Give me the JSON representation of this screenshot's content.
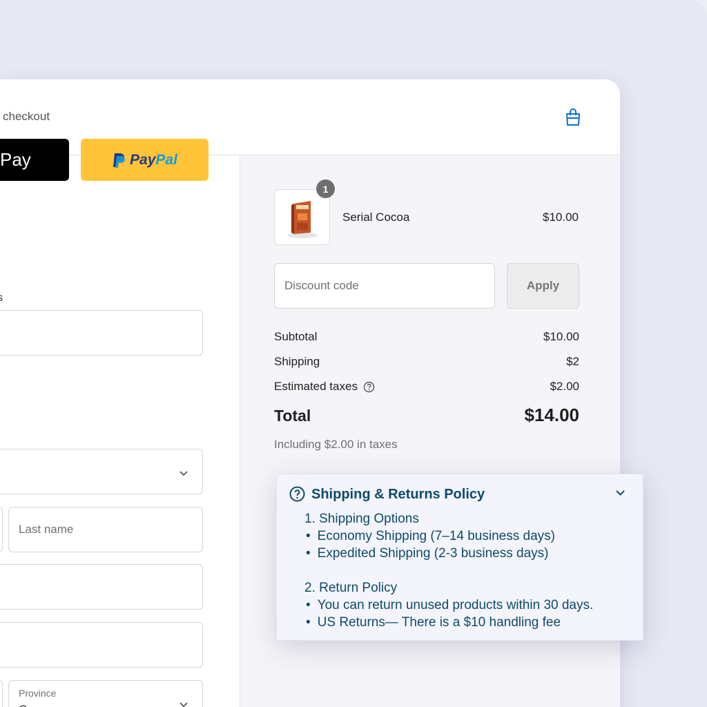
{
  "checkout": {
    "express_label": "checkout",
    "applepay_label": "Pay",
    "paypal_pay": "Pay",
    "paypal_pal": "Pal",
    "newsletter_tail": "s",
    "last_name_placeholder": "Last name",
    "province_label": "Province",
    "province_value": "C"
  },
  "order": {
    "quantity": "1",
    "product_name": "Serial Cocoa",
    "product_price": "$10.00",
    "discount_placeholder": "Discount code",
    "apply_label": "Apply",
    "subtotal_label": "Subtotal",
    "subtotal_value": "$10.00",
    "shipping_label": "Shipping",
    "shipping_value": "$2",
    "taxes_label": "Estimated taxes",
    "taxes_value": "$2.00",
    "total_label": "Total",
    "total_value": "$14.00",
    "tax_note": "Including $2.00 in taxes"
  },
  "policy": {
    "title": "Shipping & Returns Policy",
    "section1_heading": "1. Shipping Options",
    "section1_items": [
      "Economy Shipping (7–14 business days)",
      "Expedited Shipping (2-3 business days)"
    ],
    "section2_heading": "2. Return Policy",
    "section2_items": [
      "You can return unused products within 30 days.",
      "US Returns— There is a $10 handling fee"
    ]
  },
  "colors": {
    "accent": "#0b6fd1",
    "paypal_yellow": "#ffc43a",
    "policy_text": "#0f4a68"
  },
  "icons": [
    "shopping-bag-icon",
    "help-circle-icon",
    "chevron-down-icon",
    "paypal-logo-icon"
  ]
}
